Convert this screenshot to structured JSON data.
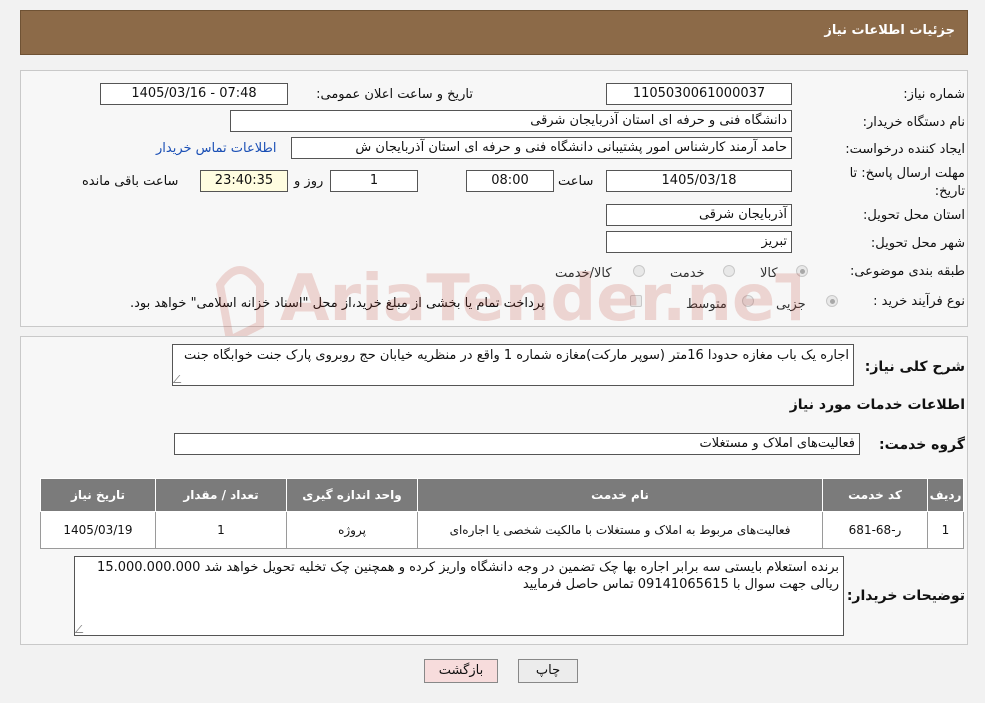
{
  "header": {
    "title": "جزئیات اطلاعات نیاز"
  },
  "form": {
    "need_number_label": "شماره نیاز:",
    "need_number": "1105030061000037",
    "announce_label": "تاریخ و ساعت اعلان عمومی:",
    "announce_value": "1405/03/16 - 07:48",
    "buyer_org_label": "نام دستگاه خریدار:",
    "buyer_org": "دانشگاه فنی و حرفه ای استان آذربایجان شرقی",
    "creator_label": "ایجاد کننده درخواست:",
    "creator": "حامد آرمند کارشناس امور پشتیبانی دانشگاه فنی و حرفه ای استان آذربایجان ش",
    "contact_link": "اطلاعات تماس خریدار",
    "deadline_label_1": "مهلت ارسال پاسخ: تا",
    "deadline_label_2": "تاریخ:",
    "deadline_date": "1405/03/18",
    "time_label": "ساعت",
    "deadline_time": "08:00",
    "days_value": "1",
    "days_label": "روز و",
    "remaining_time": "23:40:35",
    "remaining_label": "ساعت باقی مانده",
    "province_label": "استان محل تحویل:",
    "province": "آذربایجان شرقی",
    "city_label": "شهر محل تحویل:",
    "city": "تبریز",
    "category_label": "طبقه بندی موضوعی:",
    "category_options": [
      "کالا",
      "خدمت",
      "کالا/خدمت"
    ],
    "purchase_type_label": "نوع فرآیند خرید :",
    "purchase_options": [
      "جزیی",
      "متوسط"
    ],
    "purchase_note": "پرداخت تمام یا بخشی از مبلغ خرید،از محل \"اسناد خزانه اسلامی\" خواهد بود."
  },
  "summary": {
    "label": "شرح کلی نیاز:",
    "text": "اجاره یک باب مغازه حدودا 16متر (سوپر مارکت)مغازه شماره 1 واقع در منظریه خیابان حج روبروی پارک جنت خوابگاه جنت"
  },
  "services": {
    "section_title": "اطلاعات خدمات مورد نیاز",
    "group_label": "گروه خدمت:",
    "group_value": "فعالیت‌های  املاک و مستغلات",
    "columns": [
      "ردیف",
      "کد خدمت",
      "نام خدمت",
      "واحد اندازه گیری",
      "تعداد / مقدار",
      "تاریخ نیاز"
    ],
    "rows": [
      {
        "index": "1",
        "code": "ر-68-681",
        "name": "فعالیت‌های مربوط به املاک و مستغلات با مالکیت شخصی یا اجاره‌ای",
        "unit": "پروژه",
        "qty": "1",
        "date": "1405/03/19"
      }
    ]
  },
  "buyer_notes": {
    "label": "توضیحات خریدار:",
    "text": "برنده استعلام بایستی سه برابر اجاره بها چک تضمین در وجه دانشگاه واریز کرده و همچنین چک تخلیه تحویل خواهد شد 15.000.000.000 ریالی جهت سوال با 09141065615 تماس حاصل فرمایید"
  },
  "buttons": {
    "print": "چاپ",
    "back": "بازگشت"
  },
  "watermark": {
    "text": "AriaTender.neT"
  },
  "colors": {
    "header": "#8c6a48",
    "table_header": "#7b7b7b",
    "link": "#1a4fb5",
    "back_button": "#f7dcdc"
  }
}
